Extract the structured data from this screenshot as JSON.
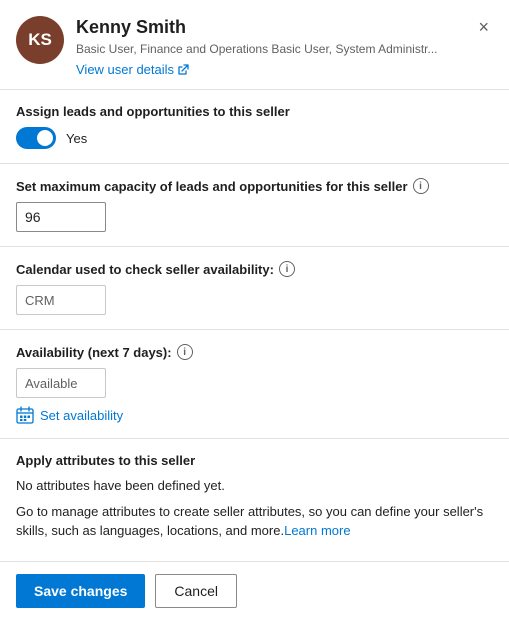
{
  "header": {
    "avatar_initials": "KS",
    "name": "Kenny Smith",
    "roles": "Basic User, Finance and Operations Basic User, System Administr...",
    "view_user_label": "View user details"
  },
  "close_button_label": "×",
  "sections": {
    "assign_leads": {
      "label": "Assign leads and opportunities to this seller",
      "toggle_value": true,
      "toggle_yes_label": "Yes"
    },
    "max_capacity": {
      "label": "Set maximum capacity of leads and opportunities for this seller",
      "input_value": "96"
    },
    "calendar": {
      "label": "Calendar used to check seller availability:",
      "input_value": "CRM"
    },
    "availability": {
      "label": "Availability (next 7 days):",
      "input_value": "Available",
      "set_availability_label": "Set availability"
    },
    "attributes": {
      "label": "Apply attributes to this seller",
      "no_attributes_text": "No attributes have been defined yet.",
      "description": "Go to manage attributes to create seller attributes, so you can define your seller's skills, such as languages, locations, and more.",
      "learn_more_label": "Learn more"
    }
  },
  "footer": {
    "save_label": "Save changes",
    "cancel_label": "Cancel"
  }
}
